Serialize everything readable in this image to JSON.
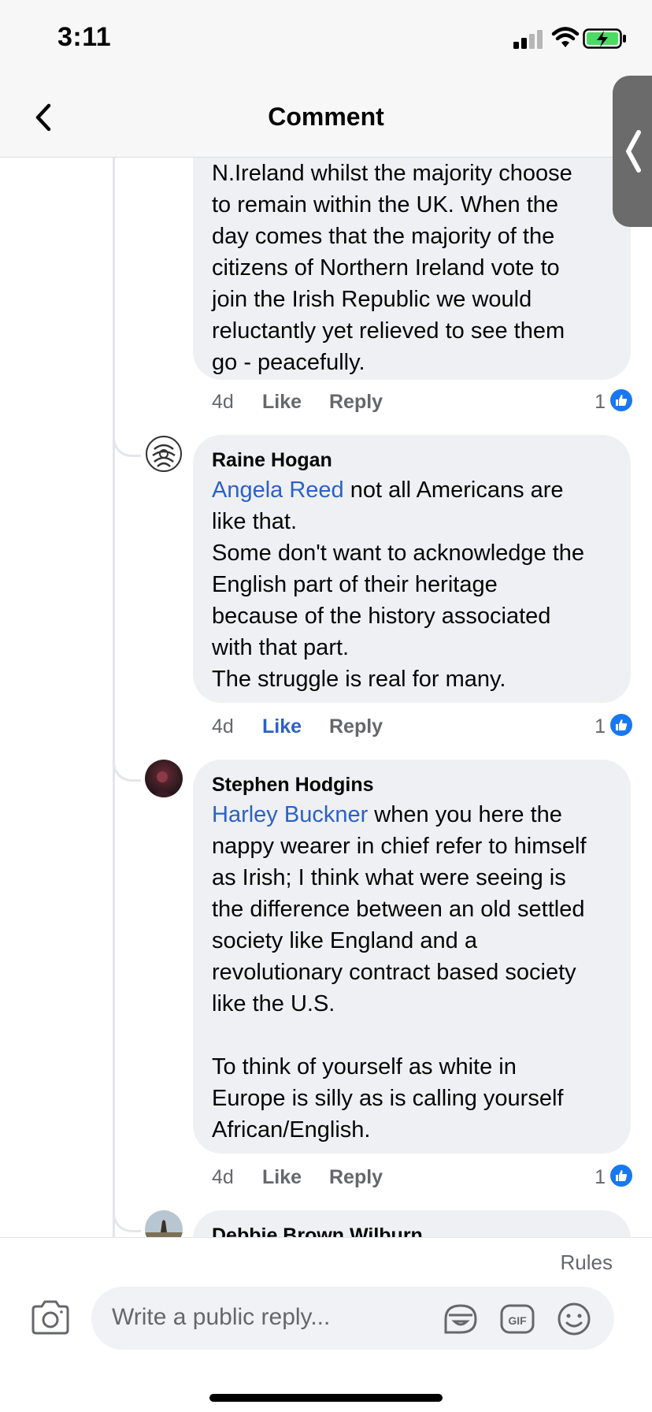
{
  "status": {
    "time": "3:11"
  },
  "nav": {
    "title": "Comment"
  },
  "comments": [
    {
      "author": "",
      "mention": "",
      "text": "N.Ireland whilst the majority choose\nto remain within the UK. When the\nday comes that the majority of the\ncitizens of Northern Ireland vote to\njoin the Irish Republic we would\nreluctantly yet relieved to see them\ngo - peacefully.",
      "time": "4d",
      "like_label": "Like",
      "reply_label": "Reply",
      "reactions": "1",
      "liked": false
    },
    {
      "author": "Raine Hogan",
      "mention": "Angela Reed",
      "text": " not all Americans are\nlike that.\nSome don't want to acknowledge the\nEnglish part of their heritage\nbecause of the history associated\nwith that part.\nThe struggle is real for many.",
      "time": "4d",
      "like_label": "Like",
      "reply_label": "Reply",
      "reactions": "1",
      "liked": true
    },
    {
      "author": "Stephen Hodgins",
      "mention": "Harley Buckner",
      "text": " when you here the\nnappy wearer in chief refer to himself\nas Irish; I think what were seeing is\nthe difference between an old settled\nsociety like England and a\nrevolutionary contract based society\nlike the U.S.\n\nTo think of yourself as white in\nEurope is silly as is calling yourself\nAfrican/English.",
      "time": "4d",
      "like_label": "Like",
      "reply_label": "Reply",
      "reactions": "1",
      "liked": false
    },
    {
      "author": "Debbie Brown Wilburn"
    }
  ],
  "composer": {
    "rules_label": "Rules",
    "placeholder": "Write a public reply..."
  },
  "icons": {
    "back": "chevron-left-icon",
    "side_tab": "chevron-left-icon",
    "camera": "camera-icon",
    "sticker": "sticker-icon",
    "gif": "gif-icon",
    "emoji": "emoji-icon",
    "reaction": "thumbs-up-icon"
  },
  "colors": {
    "mention": "#2b61c6",
    "like_active": "#2b61c6",
    "reaction_badge": "#1877f2",
    "bubble": "#eff0f3"
  }
}
